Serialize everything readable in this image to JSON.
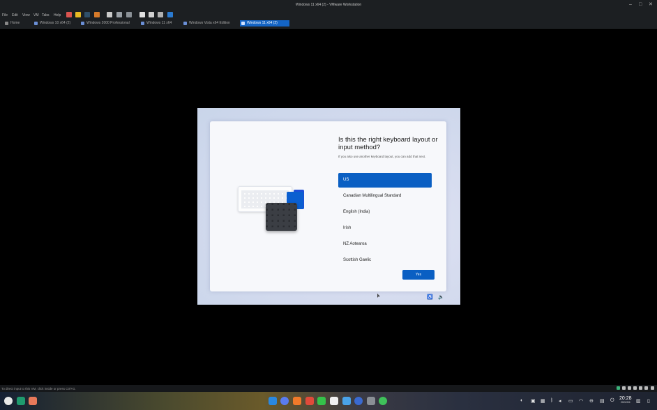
{
  "window": {
    "title": "Windows 11 x64 (2) - VMware Workstation",
    "controls": {
      "minimize": "–",
      "maximize": "□",
      "close": "✕"
    }
  },
  "menu": [
    "File",
    "Edit",
    "View",
    "VM",
    "Tabs",
    "Help"
  ],
  "tabs": [
    {
      "label": "Home",
      "active": false
    },
    {
      "label": "Windows 10 x64 (2)",
      "active": false
    },
    {
      "label": "Windows 2000 Professional",
      "active": false
    },
    {
      "label": "Windows 11 x64",
      "active": false
    },
    {
      "label": "Windows Vista x64 Edition",
      "active": false
    },
    {
      "label": "Windows 11 x64 (2)",
      "active": true
    }
  ],
  "oobe": {
    "heading": "Is this the right keyboard layout or input method?",
    "subtext": "If you also use another keyboard layout, you can add that next.",
    "options": [
      "US",
      "Canadian Multilingual Standard",
      "English (India)",
      "Irish",
      "NZ Aotearoa",
      "Scottish Gaelic"
    ],
    "selected": "US",
    "yes_label": "Yes"
  },
  "status": {
    "text": "To direct input to this VM, click inside or press Ctrl+G."
  },
  "clock": {
    "time": "20:28",
    "date": "2024/3/4"
  },
  "colors": {
    "accent": "#0a5fc3",
    "tab_active": "#1464c4",
    "chrome_bg": "#1c1f22"
  }
}
